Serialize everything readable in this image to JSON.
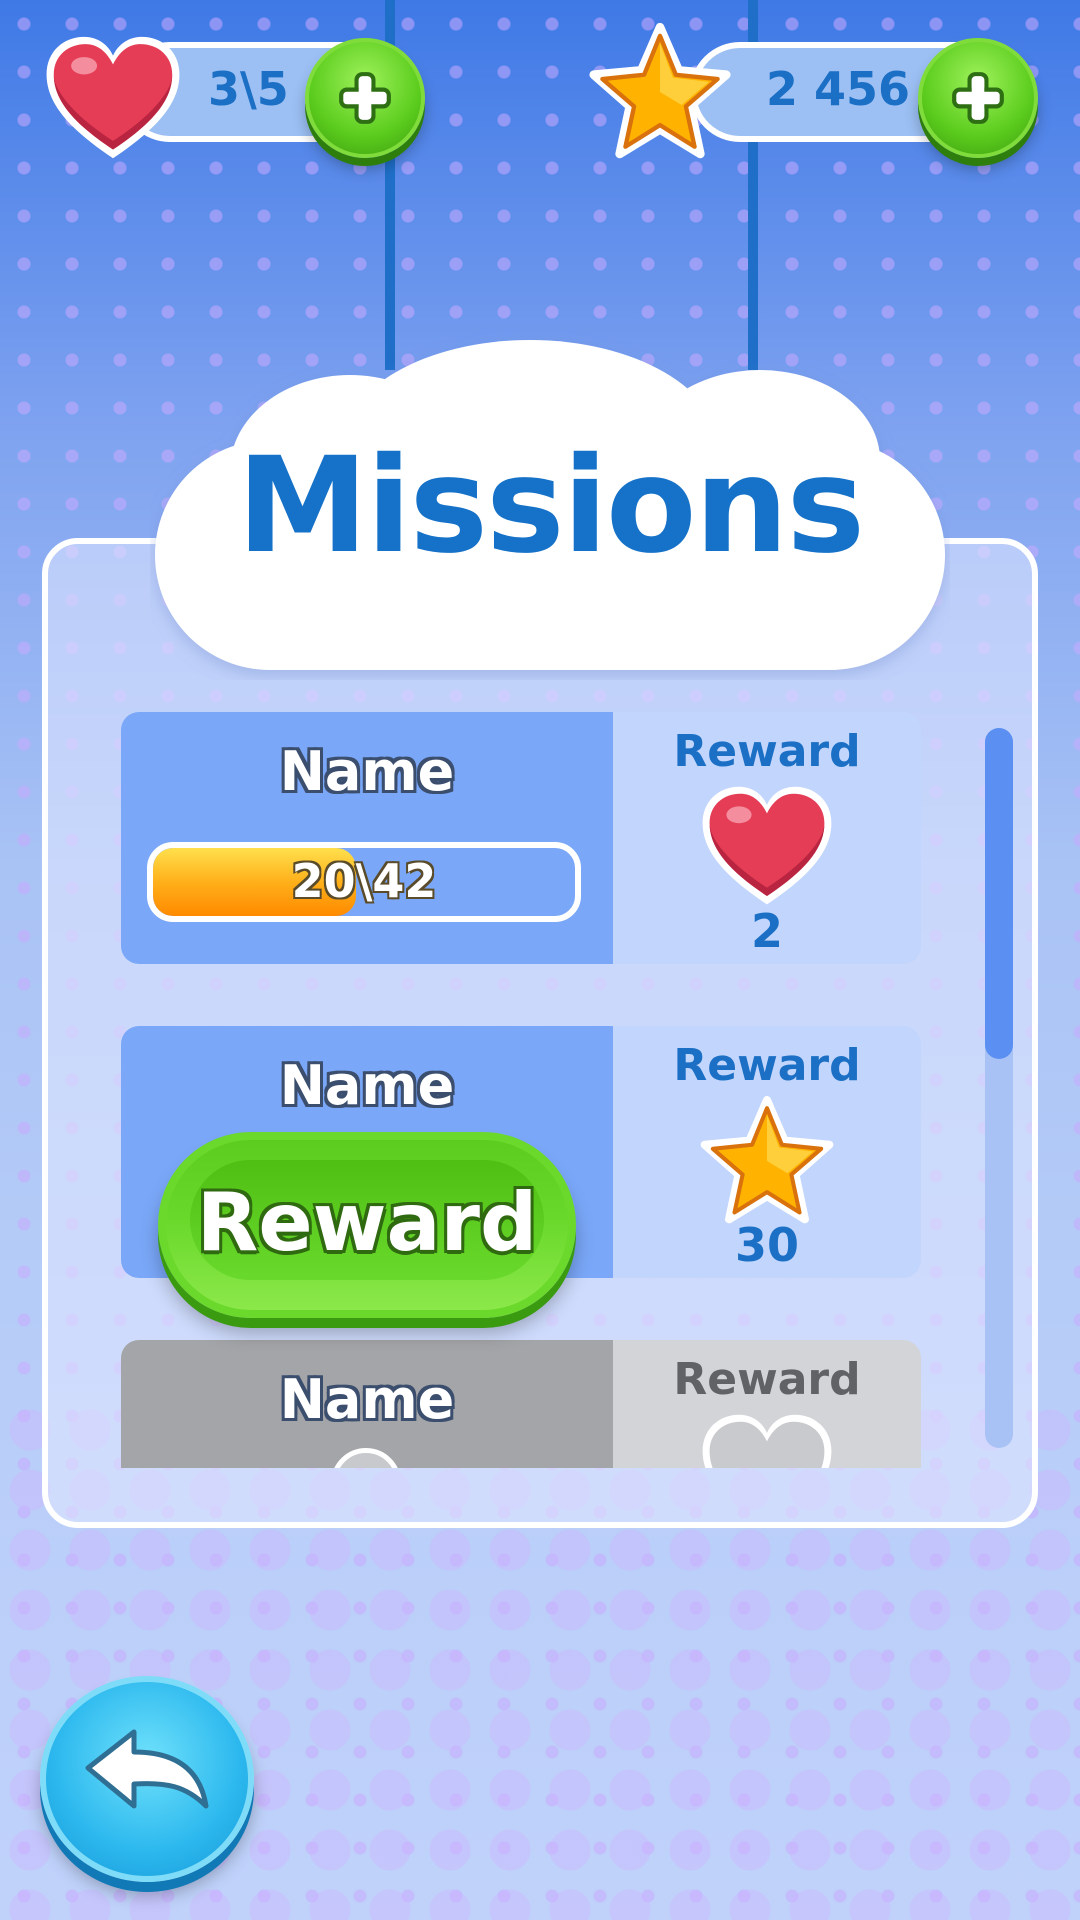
{
  "hud": {
    "lives": {
      "icon": "heart-icon",
      "value": "3\\5",
      "add_icon": "plus-icon"
    },
    "stars": {
      "icon": "star-icon",
      "value": "2 456",
      "add_icon": "plus-icon"
    }
  },
  "title": "Missions",
  "missions": [
    {
      "name": "Name",
      "state": "in-progress",
      "progress_text": "20\\42",
      "progress": 0.48,
      "reward_label": "Reward",
      "reward_icon": "heart-icon",
      "reward_amount": "2"
    },
    {
      "name": "Name",
      "state": "claimable",
      "button_label": "Reward",
      "reward_label": "Reward",
      "reward_icon": "star-icon",
      "reward_amount": "30"
    },
    {
      "name": "Name",
      "state": "locked",
      "reward_label": "Reward",
      "reward_icon": "heart-icon"
    }
  ],
  "scroll": {
    "position": 0.0,
    "visible_fraction": 0.46
  },
  "back_button": {
    "icon": "back-arrow-icon"
  },
  "colors": {
    "title": "#1672c8",
    "active_left": "#7aa7f8",
    "active_right": "#c2d5fd",
    "locked_left": "#a4a5a8",
    "locked_right": "#d3d4d7",
    "claim_green": "#5ccd1f"
  }
}
